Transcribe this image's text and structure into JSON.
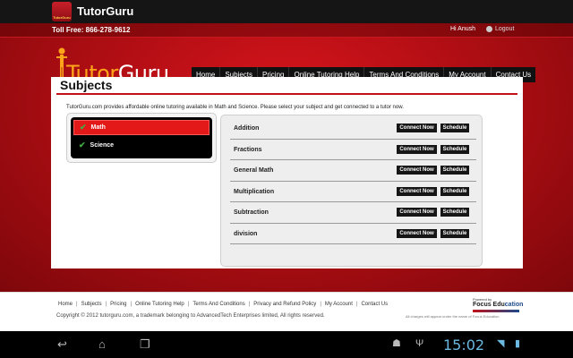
{
  "app": {
    "title": "TutorGuru",
    "icon_label": "TutorGuru"
  },
  "topbar": {
    "tollfree": "Toll Free: 866-278-9612",
    "greeting": "Hi  Anush",
    "logout": "Logout"
  },
  "logo": {
    "part1": "Tutor",
    "part2": "Guru"
  },
  "nav": [
    "Home",
    "Subjects",
    "Pricing",
    "Online Tutoring Help",
    "Terms And Conditions",
    "My Account",
    "Contact Us"
  ],
  "page": {
    "title": "Subjects",
    "intro": "TutorGuru.com provides affordable online tutoring available in Math and Science. Please select your subject and get connected to a tutor now."
  },
  "subjects": [
    {
      "label": "Math",
      "active": true
    },
    {
      "label": "Science",
      "active": false
    }
  ],
  "topics": [
    {
      "name": "Addition",
      "connect": "Connect Now",
      "schedule": "Schedule"
    },
    {
      "name": "Fractions",
      "connect": "Connect Now",
      "schedule": "Schedule"
    },
    {
      "name": "General Math",
      "connect": "Connect Now",
      "schedule": "Schedule"
    },
    {
      "name": "Multiplication",
      "connect": "Connect Now",
      "schedule": "Schedule"
    },
    {
      "name": "Subtraction",
      "connect": "Connect Now",
      "schedule": "Schedule"
    },
    {
      "name": "division",
      "connect": "Connect Now",
      "schedule": "Schedule"
    }
  ],
  "footer": {
    "links": [
      "Home",
      "Subjects",
      "Pricing",
      "Online Tutoring Help",
      "Terms And Conditions",
      "Privacy and Refund Policy",
      "My Account",
      "Contact Us"
    ],
    "copyright": "Copyright © 2012 tutorguru.com, a trademark belonging to AdvancedTech Enterprises limited, All rights reserved.",
    "powered_by": "Powered by",
    "focus_a": "Focus Edu",
    "focus_b": "cation",
    "disclaimer": "All charges will appear under the name of Focus Education"
  },
  "system": {
    "time": "15:02"
  },
  "colors": {
    "brand_red": "#c11018",
    "nav_bg": "#111111",
    "accent_orange": "#ffa41a"
  }
}
